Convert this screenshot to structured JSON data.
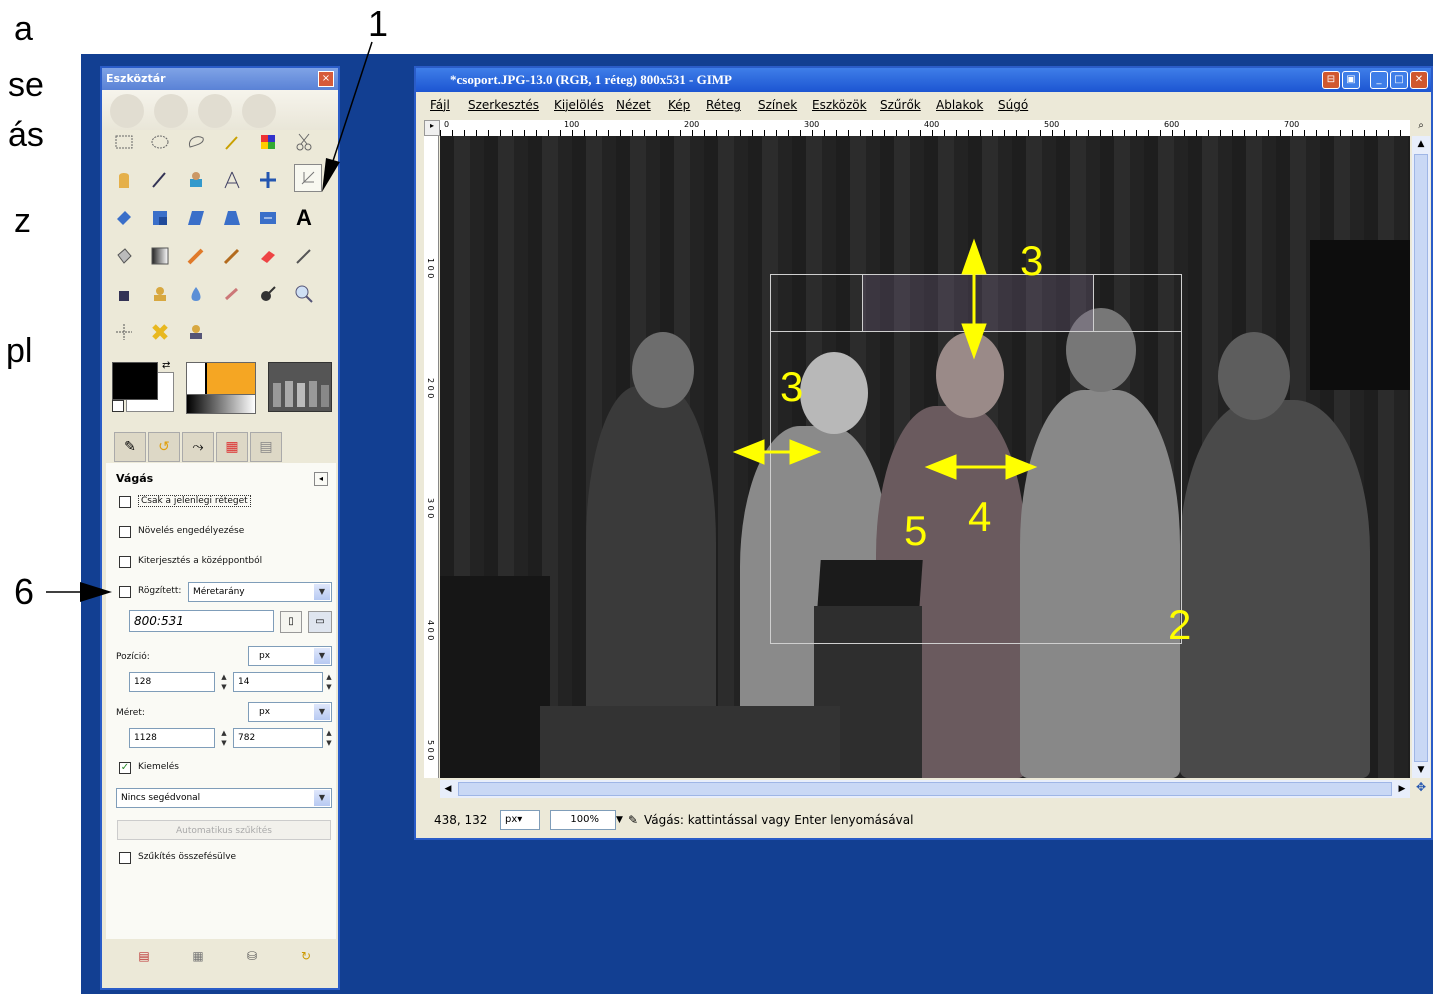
{
  "cut_text": [
    "a",
    "se",
    "ás",
    "z",
    "pl"
  ],
  "callouts": {
    "one": "1",
    "six": "6"
  },
  "toolbox": {
    "title": "Eszköztár",
    "close": "×",
    "tool_options": {
      "title": "Vágás",
      "checkbox_current_layer": "Csak a jelenlegi réteget",
      "checkbox_allow_growing": "Növelés engedélyezése",
      "checkbox_expand_center": "Kiterjesztés a középpontból",
      "fixed_label": "Rögzített:",
      "fixed_mode": "Méretarány",
      "aspect_value": "800:531",
      "position_label": "Pozíció:",
      "position_unit": "px",
      "position_x": "128",
      "position_y": "14",
      "size_label": "Méret:",
      "size_unit": "px",
      "size_w": "1128",
      "size_h": "782",
      "highlight_label": "Kiemelés",
      "guides_value": "Nincs segédvonal",
      "auto_shrink": "Automatikus szűkítés",
      "shrink_merged": "Szűkítés összefésülve"
    }
  },
  "window": {
    "title": "*csoport.JPG-13.0 (RGB, 1 réteg) 800x531 - GIMP",
    "menu": [
      "Fájl",
      "Szerkesztés",
      "Kijelölés",
      "Nézet",
      "Kép",
      "Réteg",
      "Színek",
      "Eszközök",
      "Szűrők",
      "Ablakok",
      "Súgó"
    ],
    "ruler_h": [
      "0",
      "100",
      "200",
      "300",
      "400",
      "500",
      "600",
      "700"
    ],
    "ruler_v": [
      "1 0 0",
      "2 0 0",
      "3 0 0",
      "4 0 0",
      "5 0 0"
    ]
  },
  "annotations": {
    "a3_top": "3",
    "a3_left": "3",
    "a4": "4",
    "a5": "5",
    "a2": "2"
  },
  "status": {
    "coords": "438, 132",
    "unit": "px",
    "zoom": "100%",
    "message": "Vágás: kattintással vagy Enter lenyomásával"
  },
  "colors": {
    "desktop": "#123f92",
    "annotation": "#ffff00",
    "titlebar": "#1c55d2"
  }
}
